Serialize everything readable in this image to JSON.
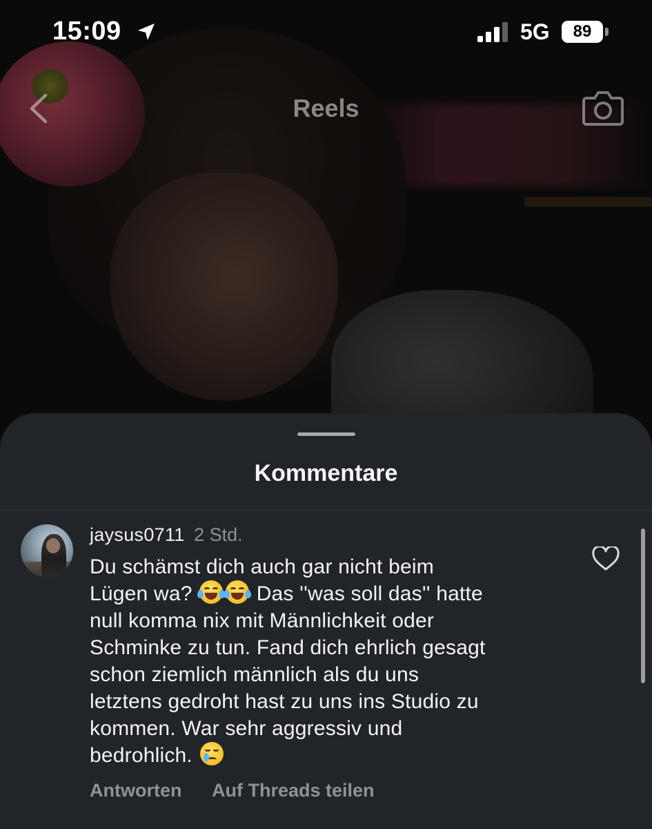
{
  "status_bar": {
    "time": "15:09",
    "network": "5G",
    "battery": "89",
    "signal_bars": 3,
    "signal_bars_total": 4
  },
  "header": {
    "title": "Reels",
    "icons": [
      "back-chevron-icon",
      "camera-icon"
    ]
  },
  "comments_sheet": {
    "title": "Kommentare",
    "comment": {
      "username": "jaysus0711",
      "time": "2 Std.",
      "lines": [
        "Du schämst dich auch gar nicht beim",
        "Lügen wa?",
        "Das ''was soll das'' hatte",
        "null komma nix mit Männlichkeit oder",
        "Schminke zu tun. Fand dich ehrlich gesagt",
        "schon ziemlich männlich als du uns",
        "letztens gedroht hast zu uns ins Studio zu",
        "kommen. War sehr aggressiv und",
        "bedrohlich."
      ],
      "emojis": [
        "face-with-tears-of-joy",
        "face-with-tears-of-joy",
        "crying-face"
      ],
      "reply_label": "Antworten",
      "share_label": "Auf Threads teilen"
    }
  },
  "colors": {
    "sheet_background": "#212428",
    "secondary_text": "#8e9196",
    "primary_text": "#f4f4f4"
  }
}
